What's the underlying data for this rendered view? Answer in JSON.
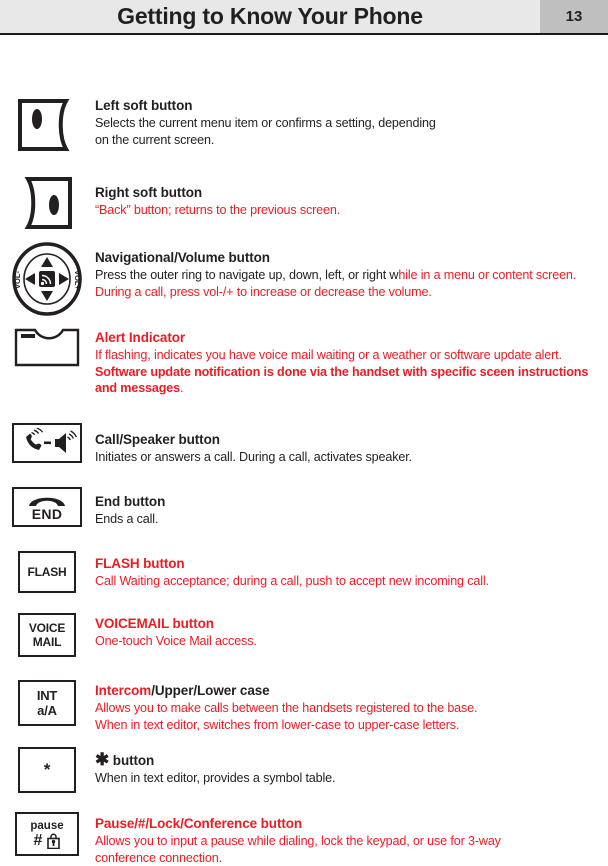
{
  "header": {
    "title": "Getting to Know Your Phone",
    "page_number": "13",
    "bg_color": "#e8e8e8",
    "page_number_bg": "#bfbfbf",
    "rule_color": "#1a1a1a"
  },
  "colors": {
    "red": "#ed1c24",
    "black": "#231f20"
  },
  "entries": [
    {
      "icon_name": "left-soft-button-icon",
      "title": "Left soft button",
      "title_color": "#231f20",
      "desc_line1": "Selects the current menu item or confirms a setting, depending",
      "desc_line2": "on the current screen.",
      "desc_color": "#231f20"
    },
    {
      "icon_name": "right-soft-button-icon",
      "title": "Right soft button",
      "title_color": "#231f20",
      "desc_line1": "“Back” button; returns to the previous screen.",
      "desc_color": "#ed1c24"
    },
    {
      "icon_name": "navigational-volume-button-icon",
      "title": "Navigational/Volume button",
      "title_color": "#231f20",
      "desc_part_black": "Press the outer ring to navigate up, down, left, or right w",
      "desc_part_red": "hile in a menu or content screen. During a call, press vol-/+ to increase or decrease the volume.",
      "icon_labels": {
        "left": "VOL-",
        "right": "VOL+"
      }
    },
    {
      "icon_name": "alert-indicator-icon",
      "title": "Alert Indicator",
      "title_color": "#ed1c24",
      "desc_normal_1": "If flashing, indicates you have voice mail waiting or a weather or software update alert. ",
      "desc_bold": "Software update notification is done via the handset with specific sceen instructions and messages",
      "desc_normal_2": ".",
      "desc_color": "#ed1c24"
    },
    {
      "icon_name": "call-speaker-button-icon",
      "title": "Call/Speaker button",
      "title_color": "#231f20",
      "desc_line1": "Initiates or answers a call.  During a call, activates speaker.",
      "desc_color": "#231f20"
    },
    {
      "icon_name": "end-button-icon",
      "icon_label": "END",
      "title": "End button",
      "title_color": "#231f20",
      "desc_line1": "Ends a call.",
      "desc_color": "#231f20"
    },
    {
      "icon_name": "flash-button-icon",
      "icon_label": "FLASH",
      "title": "FLASH button",
      "title_color": "#ed1c24",
      "desc_line1": "Call Waiting acceptance; during a call, push to accept new incoming call.",
      "desc_color": "#ed1c24"
    },
    {
      "icon_name": "voicemail-button-icon",
      "icon_label_line1": "VOICE",
      "icon_label_line2": "MAIL",
      "title": "VOICEMAIL button",
      "title_color": "#ed1c24",
      "desc_line1": "One-touch Voice Mail access.",
      "desc_color": "#ed1c24"
    },
    {
      "icon_name": "intercom-button-icon",
      "icon_label_line1": "INT",
      "icon_label_line2": "a/A",
      "title_red": "Intercom",
      "title_black": "/Upper/Lower case",
      "desc_line1": "Allows you to make calls between the handsets registered to the base.",
      "desc_line2": "When in text editor, switches from lower-case to upper-case letters.",
      "desc_color": "#ed1c24"
    },
    {
      "icon_name": "star-button-icon",
      "icon_label": "*",
      "title_glyph": "✱",
      "title_text": " button",
      "title_color": "#231f20",
      "desc_line1": "When in text editor, provides a symbol table.",
      "desc_color": "#231f20"
    },
    {
      "icon_name": "pause-lock-conference-button-icon",
      "icon_label_line1": "pause",
      "icon_label_hash": "#",
      "icon_label_lock": "lock-icon",
      "title": "Pause/#/Lock/Conference button",
      "title_color": "#ed1c24",
      "desc_line1": "Allows you to input a pause while dialing, lock the keypad, or use for 3-way",
      "desc_line2": "conference connection.",
      "desc_color": "#ed1c24"
    }
  ]
}
